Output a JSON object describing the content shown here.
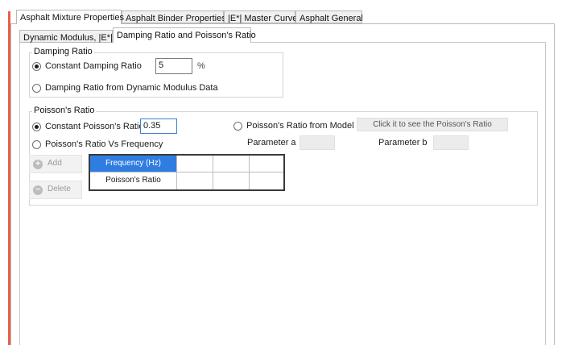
{
  "main_tabs": [
    {
      "label": "Asphalt Mixture Properties",
      "active": true
    },
    {
      "label": "Asphalt Binder Properties",
      "active": false
    },
    {
      "label": "|E*| Master Curve",
      "active": false
    },
    {
      "label": "Asphalt General",
      "active": false
    }
  ],
  "sub_tabs": [
    {
      "label": "Dynamic Modulus, |E*|",
      "active": false
    },
    {
      "label": "Damping Ratio and Poisson's Ratio",
      "active": true
    }
  ],
  "damping": {
    "title": "Damping Ratio",
    "constant_label": "Constant Damping Ratio",
    "constant_value": "5",
    "unit": "%",
    "from_dm_label": "Damping Ratio from Dynamic Modulus Data"
  },
  "poisson": {
    "title": "Poisson's Ratio",
    "constant_label": "Constant Poisson's Ratio",
    "constant_value": "0.35",
    "vs_freq_label": "Poisson's Ratio Vs Frequency",
    "from_model_label": "Poisson's Ratio from Model",
    "see_button_label": "Click it to see the Poisson's Ratio",
    "param_a_label": "Parameter a",
    "param_b_label": "Parameter b",
    "add_label": "Add",
    "delete_label": "Delete",
    "table": {
      "row_headers": [
        "Frequency (Hz)",
        "Poisson's Ratio"
      ]
    }
  },
  "colors": {
    "header_cell": "#2f7de1",
    "left_accent": "#e8604a"
  },
  "icons": {
    "add": "plus-circle-icon",
    "delete": "minus-circle-icon"
  }
}
